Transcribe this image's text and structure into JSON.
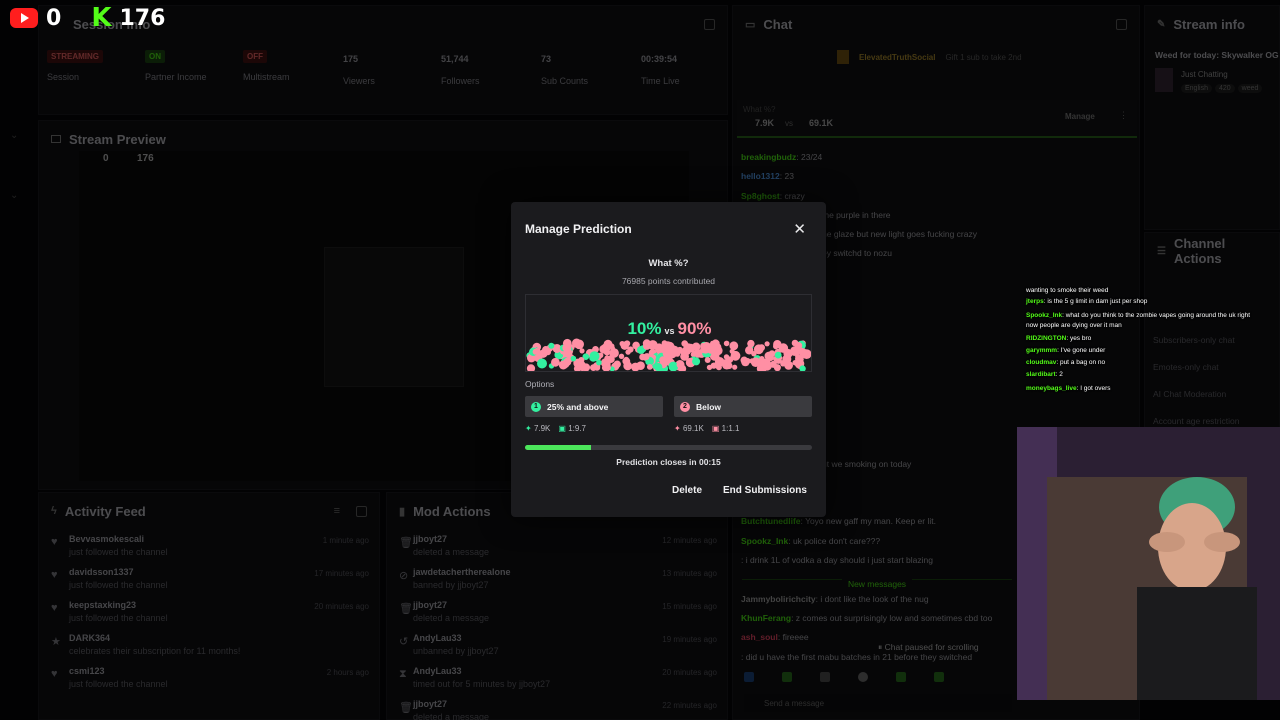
{
  "overlay": {
    "youtube_count": "0",
    "kick_count": "176"
  },
  "session": {
    "title": "Session Info",
    "badges": [
      "STREAMING",
      "ON",
      "OFF"
    ],
    "stats": [
      {
        "value": "",
        "label": "Session"
      },
      {
        "value": "",
        "label": "Partner Income"
      },
      {
        "value": "",
        "label": "Multistream"
      },
      {
        "value": "175",
        "label": "Viewers"
      },
      {
        "value": "51,744",
        "label": "Followers"
      },
      {
        "value": "73",
        "label": "Sub Counts"
      },
      {
        "value": "00:39:54",
        "label": "Time Live"
      }
    ]
  },
  "preview": {
    "title": "Stream Preview",
    "yt": "0",
    "kick": "176"
  },
  "activity": {
    "title": "Activity Feed",
    "items": [
      {
        "name": "Bevvasmokescali",
        "sub": "just followed the channel",
        "time": "1 minute ago"
      },
      {
        "name": "davidsson1337",
        "sub": "just followed the channel",
        "time": "17 minutes ago"
      },
      {
        "name": "keepstaxking23",
        "sub": "just followed the channel",
        "time": "20 minutes ago"
      },
      {
        "name": "DARK364",
        "sub": "celebrates their subscription for 11 months!",
        "time": ""
      },
      {
        "name": "csmi123",
        "sub": "just followed the channel",
        "time": "2 hours ago"
      }
    ]
  },
  "mod": {
    "title": "Mod Actions",
    "items": [
      {
        "name": "jjboyt27",
        "sub": "deleted a message",
        "time": "12 minutes ago"
      },
      {
        "name": "jawdetachertherealone",
        "sub": "banned by jjboyt27",
        "time": "13 minutes ago"
      },
      {
        "name": "jjboyt27",
        "sub": "deleted a message",
        "time": "15 minutes ago"
      },
      {
        "name": "AndyLau33",
        "sub": "unbanned by jjboyt27",
        "time": "19 minutes ago"
      },
      {
        "name": "AndyLau33",
        "sub": "timed out for 5 minutes by jjboyt27",
        "time": "20 minutes ago"
      },
      {
        "name": "jjboyt27",
        "sub": "deleted a message",
        "time": "22 minutes ago"
      }
    ]
  },
  "chat": {
    "title": "Chat",
    "gift_user": "ElevatedTruthSocial",
    "gift_text": "Gift 1 sub to take 2nd",
    "pred_question": "What %?",
    "pred_left": "7.9K",
    "pred_vs": "vs",
    "pred_right": "69.1K",
    "manage": "Manage",
    "lines": [
      {
        "user": "breakingbudz",
        "text": ": 23/24",
        "color": "#53fc18"
      },
      {
        "user": "hello1312",
        "text": ": 23",
        "color": "#5aa9ff"
      },
      {
        "user": "Sp8ghost",
        "text": ": crazy",
        "color": "#53fc18"
      },
      {
        "user": "",
        "text": "me purple in there",
        "color": "#53fc18"
      },
      {
        "user": "",
        "text": "ne glaze but new light goes fucking crazy",
        "color": "#53fc18"
      },
      {
        "user": "",
        "text": "ey switchd to nozu",
        "color": "#53fc18"
      },
      {
        "user": "",
        "text": "ut we smoking on today",
        "color": "#53fc18"
      },
      {
        "user": "Butchtunedlife",
        "text": ": Yoyo new gaff my man. Keep er lit.",
        "color": "#53fc18"
      },
      {
        "user": "Spookz_Ink",
        "text": ": uk police don't care???",
        "color": "#53fc18"
      },
      {
        "user": "",
        "text": ": i drink 1L of vodka a day should i just start blazing",
        "color": "#ff4d6d"
      },
      {
        "user": "Jammybolirichcity",
        "text": ": i dont like the look of the nug",
        "color": "#b0b0b0"
      },
      {
        "user": "KhunFerang",
        "text": ": z comes out surprisingly low and sometimes cbd too",
        "color": "#53fc18"
      },
      {
        "user": "ash_soul",
        "text": ": fireeee",
        "color": "#ff4d6d"
      },
      {
        "user": "",
        "text": ": did u have the first mabu batches in 21 before they switched",
        "color": "#ff4d6d"
      }
    ],
    "new_messages": "New messages",
    "paused": "Chat paused for scrolling",
    "send_placeholder": "Send a message"
  },
  "stream_info": {
    "title": "Stream info",
    "stream_title": "Weed for today: Skywalker OG",
    "category": "Just Chatting",
    "tags": [
      "English",
      "420",
      "weed"
    ]
  },
  "channel_actions": {
    "title": "Channel Actions",
    "items": [
      "Subscribers-only chat",
      "Emotes-only chat",
      "AI Chat Moderation",
      "Account age restriction"
    ]
  },
  "floating_chat": [
    {
      "user": "",
      "text": "wanting to smoke their weed"
    },
    {
      "user": "jterps",
      "text": ": is the 5 g limit in dam just per shop"
    },
    {
      "user": "Spookz_Ink",
      "text": ": what do you think to the zombie vapes going around the uk right"
    },
    {
      "user": "",
      "text": "now people are dying over it man"
    },
    {
      "user": "RIDZINGTON",
      "text": ": yes bro"
    },
    {
      "user": "garymmm",
      "text": ": I've gone under"
    },
    {
      "user": "cloudmav",
      "text": ": put a bag on no"
    },
    {
      "user": "slardibart",
      "text": ": 2"
    },
    {
      "user": "moneybags_live",
      "text": ": I got overs"
    }
  ],
  "modal": {
    "title": "Manage Prediction",
    "question": "What %?",
    "points": "76985 points contributed",
    "left_pct": "10%",
    "vs": "vs",
    "right_pct": "90%",
    "options_label": "Options",
    "option1": {
      "num": "1",
      "label": "25% and above",
      "points": "7.9K",
      "ratio": "1:9.7"
    },
    "option2": {
      "num": "2",
      "label": "Below",
      "points": "69.1K",
      "ratio": "1:1.1"
    },
    "progress": 0.23,
    "closes_label": "Prediction closes in 00:15",
    "delete_label": "Delete",
    "end_label": "End Submissions",
    "colors": {
      "option1": "#33f0a0",
      "option2": "#ff8fa4",
      "progress": "#4ce65b"
    }
  }
}
